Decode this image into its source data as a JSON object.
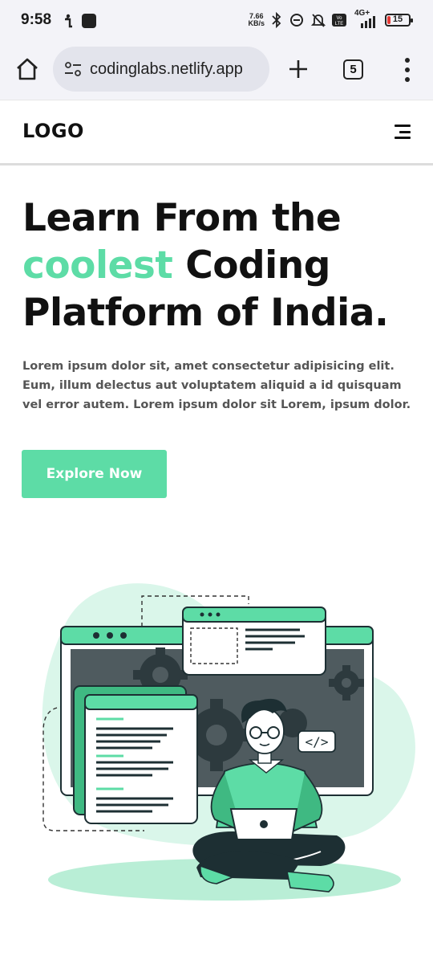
{
  "status_bar": {
    "time": "9:58",
    "net_speed_value": "7.66",
    "net_speed_unit": "KB/s",
    "network": "4G+",
    "battery": "15",
    "battery_level": 0.15
  },
  "browser": {
    "url": "codinglabs.netlify.app",
    "tab_count": "5"
  },
  "site": {
    "logo": "LOGO"
  },
  "hero": {
    "title_line1": "Learn From the",
    "title_accent": "coolest",
    "title_line2_rest": " Coding",
    "title_line3": "Platform of India.",
    "description": "Lorem ipsum dolor sit, amet consectetur adipisicing elit. Eum, illum delectus aut voluptatem aliquid a id quisquam vel error autem. Lorem ipsum dolor sit Lorem, ipsum dolor.",
    "cta_label": "Explore Now",
    "code_tag": "</>"
  },
  "colors": {
    "accent": "#5ddca6",
    "dark": "#1d2f33",
    "screen": "#4f5b5f",
    "blob": "#daf6ea"
  }
}
